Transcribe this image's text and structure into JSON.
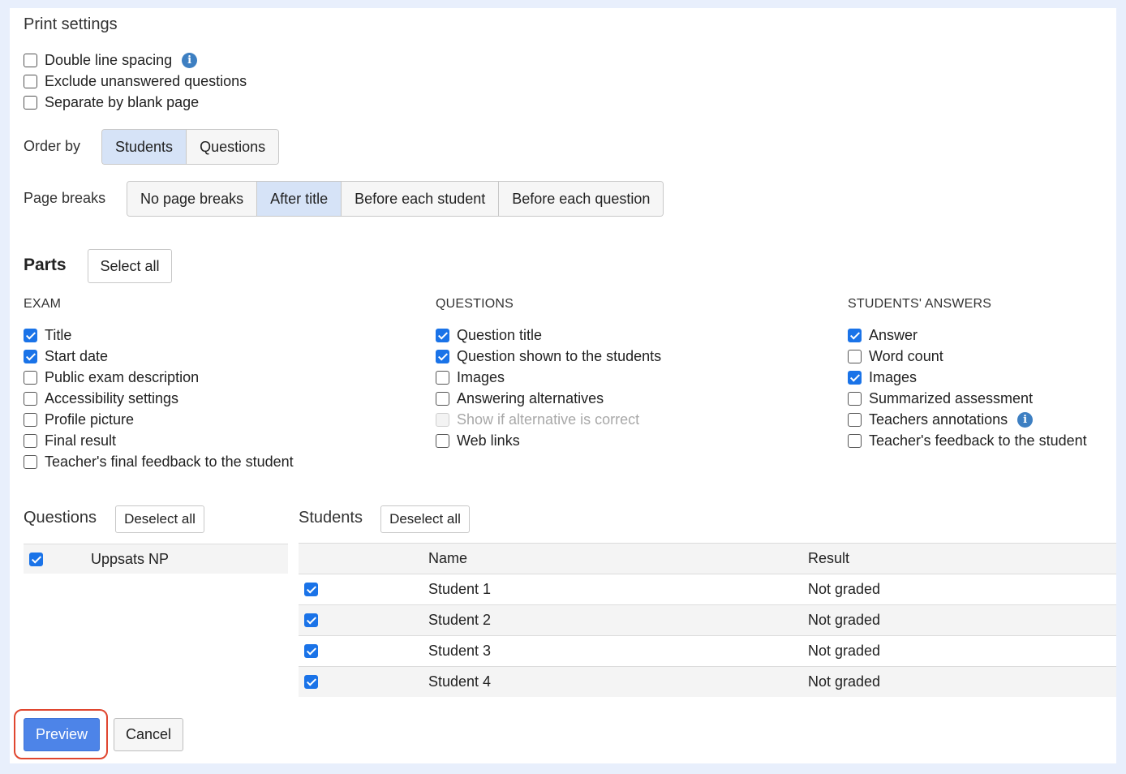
{
  "print_settings": {
    "title": "Print settings",
    "options": [
      {
        "label": "Double line spacing",
        "checked": false,
        "info": true
      },
      {
        "label": "Exclude unanswered questions",
        "checked": false
      },
      {
        "label": "Separate by blank page",
        "checked": false
      }
    ],
    "order_by": {
      "label": "Order by",
      "options": [
        "Students",
        "Questions"
      ],
      "selected": "Students"
    },
    "page_breaks": {
      "label": "Page breaks",
      "options": [
        "No page breaks",
        "After title",
        "Before each student",
        "Before each question"
      ],
      "selected": "After title"
    }
  },
  "parts": {
    "title": "Parts",
    "select_all_label": "Select all",
    "exam": {
      "heading": "EXAM",
      "items": [
        {
          "label": "Title",
          "checked": true
        },
        {
          "label": "Start date",
          "checked": true
        },
        {
          "label": "Public exam description",
          "checked": false
        },
        {
          "label": "Accessibility settings",
          "checked": false
        },
        {
          "label": "Profile picture",
          "checked": false
        },
        {
          "label": "Final result",
          "checked": false
        },
        {
          "label": "Teacher's final feedback to the student",
          "checked": false
        }
      ]
    },
    "questions": {
      "heading": "QUESTIONS",
      "items": [
        {
          "label": "Question title",
          "checked": true
        },
        {
          "label": "Question shown to the students",
          "checked": true
        },
        {
          "label": "Images",
          "checked": false
        },
        {
          "label": "Answering alternatives",
          "checked": false
        },
        {
          "label": "Show if alternative is correct",
          "checked": false,
          "disabled": true
        },
        {
          "label": "Web links",
          "checked": false
        }
      ]
    },
    "answers": {
      "heading": "STUDENTS' ANSWERS",
      "items": [
        {
          "label": "Answer",
          "checked": true
        },
        {
          "label": "Word count",
          "checked": false
        },
        {
          "label": "Images",
          "checked": true
        },
        {
          "label": "Summarized assessment",
          "checked": false
        },
        {
          "label": "Teachers annotations",
          "checked": false,
          "info": true
        },
        {
          "label": "Teacher's feedback to the student",
          "checked": false
        }
      ]
    }
  },
  "questions_list": {
    "title": "Questions",
    "deselect_label": "Deselect all",
    "rows": [
      {
        "label": "Uppsats NP",
        "checked": true
      }
    ]
  },
  "students_list": {
    "title": "Students",
    "deselect_label": "Deselect all",
    "columns": [
      "Name",
      "Result"
    ],
    "rows": [
      {
        "name": "Student 1",
        "result": "Not graded",
        "checked": true
      },
      {
        "name": "Student 2",
        "result": "Not graded",
        "checked": true
      },
      {
        "name": "Student 3",
        "result": "Not graded",
        "checked": true
      },
      {
        "name": "Student 4",
        "result": "Not graded",
        "checked": true
      }
    ]
  },
  "actions": {
    "preview_label": "Preview",
    "cancel_label": "Cancel"
  },
  "colors": {
    "accent": "#1a73e8",
    "primary_button": "#4d84e8",
    "active_segment": "#d6e3f7",
    "highlight_ring": "#e0462f",
    "page_background": "#e8effc"
  }
}
